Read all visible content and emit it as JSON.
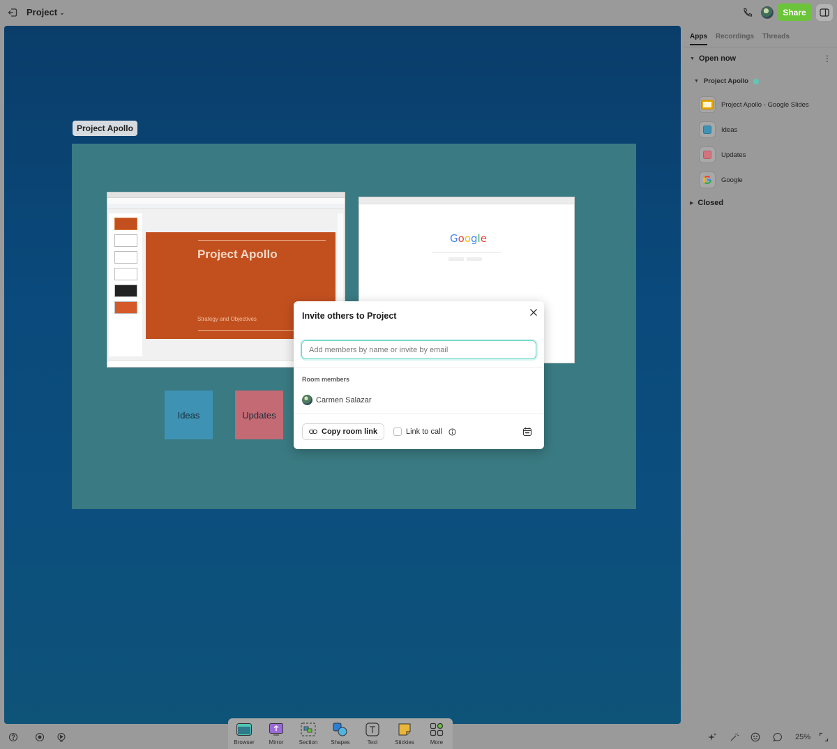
{
  "topbar": {
    "project_title": "Project",
    "share_label": "Share"
  },
  "canvas": {
    "section_label": "Project Apollo",
    "slides_window": {
      "slide_title": "Project Apollo",
      "slide_subtitle": "Strategy and Objectives"
    },
    "stickies": [
      {
        "label": "Ideas",
        "color": "#3e93b5"
      },
      {
        "label": "Updates",
        "color": "#c46a74"
      }
    ]
  },
  "panel": {
    "tabs": [
      "Apps",
      "Recordings",
      "Threads"
    ],
    "active_tab": "Apps",
    "open_now_label": "Open now",
    "room_name": "Project Apollo",
    "apps": [
      {
        "label": "Project Apollo - Google Slides",
        "icon": "slides-icon"
      },
      {
        "label": "Ideas",
        "icon": "sticky-icon"
      },
      {
        "label": "Updates",
        "icon": "sticky-icon"
      },
      {
        "label": "Google",
        "icon": "google-icon"
      }
    ],
    "closed_label": "Closed"
  },
  "modal": {
    "title": "Invite others to Project",
    "input_placeholder": "Add members by name or invite by email",
    "members_label": "Room members",
    "members": [
      "Carmen Salazar"
    ],
    "copy_link_label": "Copy room link",
    "link_to_call_label": "Link to call"
  },
  "toolbar": {
    "tools": [
      "Browser",
      "Mirror",
      "Section",
      "Shapes",
      "Text",
      "Stickies",
      "More"
    ]
  },
  "zoom": "25%",
  "colors": {
    "accent": "#6cc43b",
    "canvas_bg": "#0a4a7c",
    "section_bg": "#3a7a82",
    "input_focus": "#5fd3c2"
  }
}
